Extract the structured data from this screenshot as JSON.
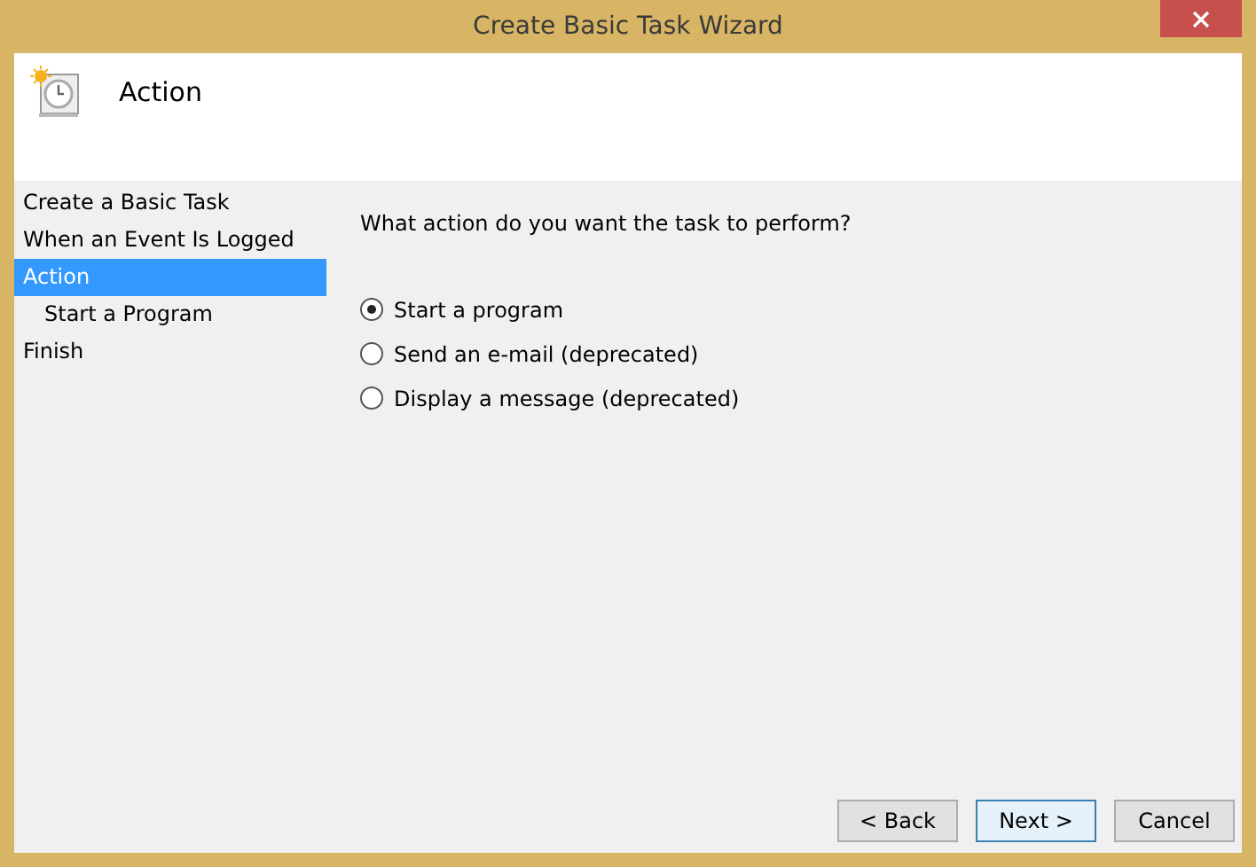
{
  "window": {
    "title": "Create Basic Task Wizard"
  },
  "header": {
    "title": "Action"
  },
  "steps": [
    {
      "label": "Create a Basic Task",
      "selected": false
    },
    {
      "label": "When an Event Is Logged",
      "selected": false
    },
    {
      "label": "Action",
      "selected": true,
      "children": [
        {
          "label": "Start a Program",
          "selected": false
        }
      ]
    },
    {
      "label": "Finish",
      "selected": false
    }
  ],
  "question": "What action do you want the task to perform?",
  "options": [
    {
      "label": "Start a program",
      "selected": true
    },
    {
      "label": "Send an e-mail (deprecated)",
      "selected": false
    },
    {
      "label": "Display a message (deprecated)",
      "selected": false
    }
  ],
  "buttons": [
    {
      "label": "< Back",
      "focused": false
    },
    {
      "label": "Next >",
      "focused": true
    },
    {
      "label": "Cancel",
      "focused": false
    }
  ]
}
